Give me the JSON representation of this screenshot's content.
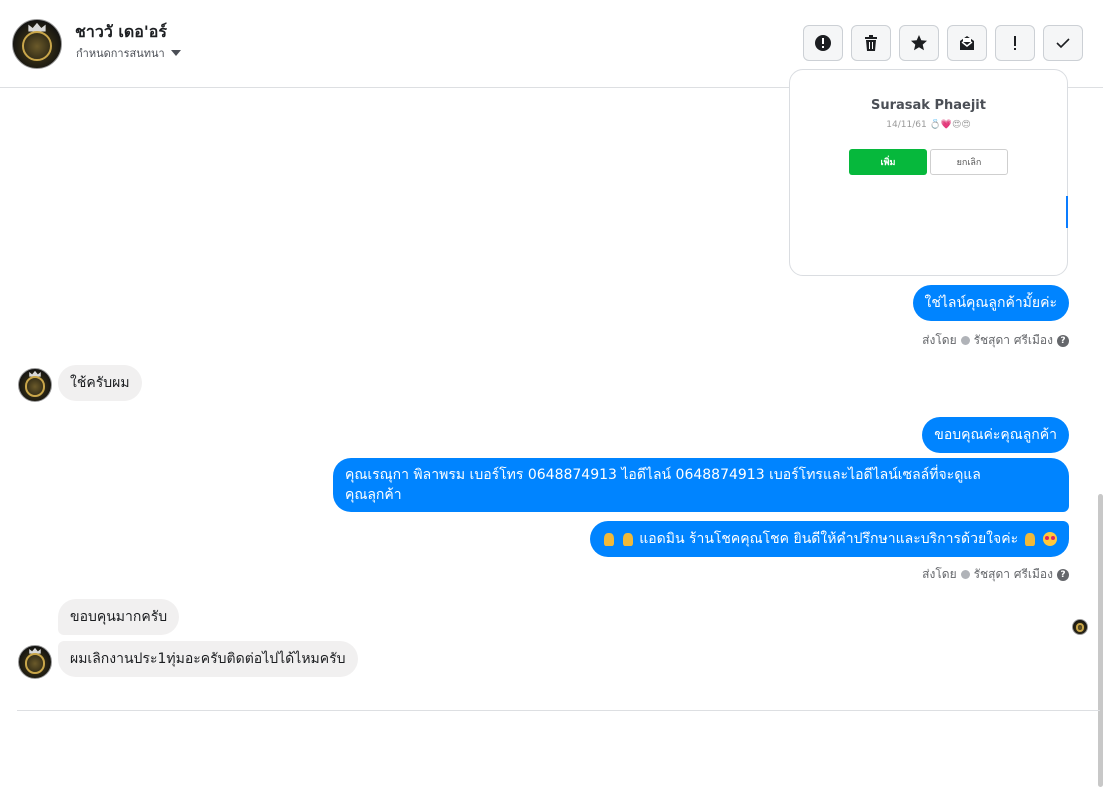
{
  "header": {
    "contact_name": "ชาววั เดอ'อร์",
    "set_conversation_label": "กำหนดการสนทนา",
    "toolbar": [
      {
        "name": "report-icon",
        "label": "!"
      },
      {
        "name": "trash-icon"
      },
      {
        "name": "star-icon"
      },
      {
        "name": "mark-unread-icon"
      },
      {
        "name": "priority-icon",
        "label": "!"
      },
      {
        "name": "done-icon"
      }
    ]
  },
  "card": {
    "name": "Surasak Phaejit",
    "status": "14/11/61 💍💗😍😍",
    "add_label": "เพิ่ม",
    "cancel_label": "ยกเลิก"
  },
  "messages": {
    "m1": "ใช่ไลน์คุณลูกค้ามั้ยค่ะ",
    "sent_by_1": "ส่งโดย",
    "sender_1": "รัชสุดา ศรีเมือง",
    "m2": "ใช้ครับผม",
    "m3": "ขอบคุณค่ะคุณลูกค้า",
    "m4_line1": "คุณเรณุกา พิลาพรม        เบอร์โทร 0648874913  ไอดีไลน์ 0648874913   เบอร์โทรและไอดีไลน์เซลล์ที่จะดูแล",
    "m4_line2": "คุณลุกค้า",
    "m5": "แอดมิน ร้านโชคคุณโชค ยินดีให้คำปรึกษาและบริการด้วยใจค่ะ",
    "sent_by_2": "ส่งโดย",
    "sender_2": "รัชสุดา ศรีเมือง",
    "m6": "ขอบคุนมากครับ",
    "m7": "ผมเลิกงานประ1ทุ่มอะครับติดต่อไปได้ไหมครับ"
  }
}
